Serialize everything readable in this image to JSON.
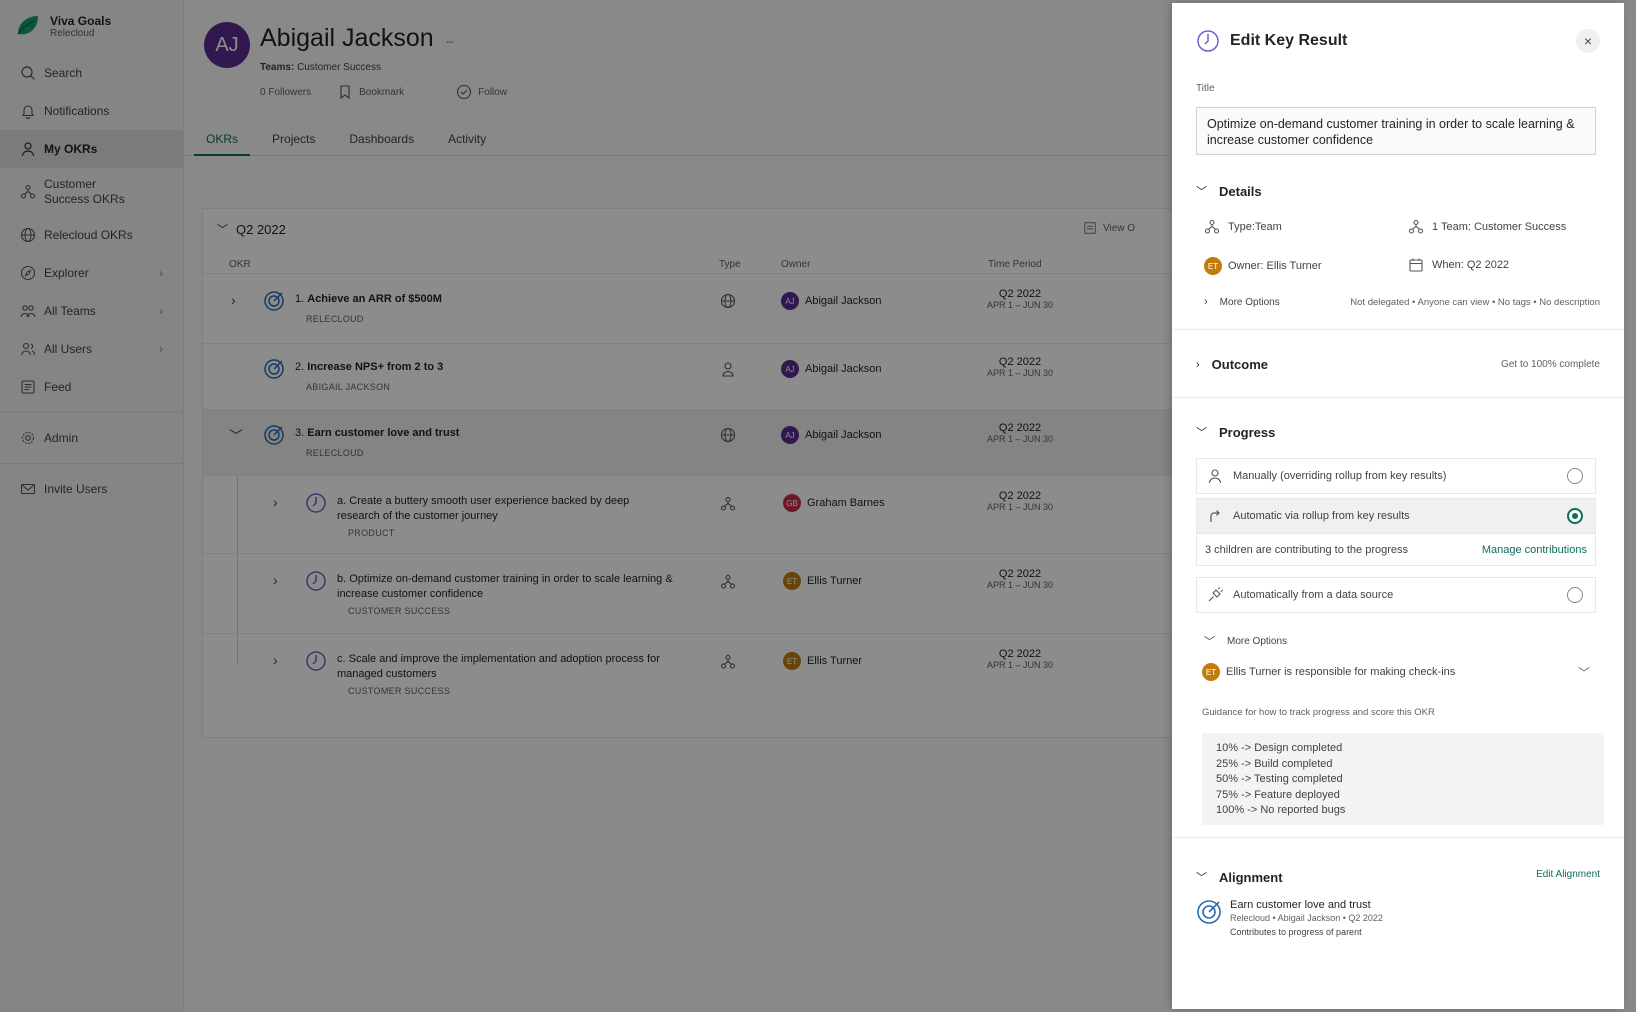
{
  "brand": {
    "name": "Viva Goals",
    "org": "Relecloud"
  },
  "sidebar": {
    "items": [
      {
        "label": "Search"
      },
      {
        "label": "Notifications"
      },
      {
        "label": "My OKRs"
      },
      {
        "label": "Customer Success OKRs"
      },
      {
        "label": "Relecloud OKRs"
      },
      {
        "label": "Explorer"
      },
      {
        "label": "All Teams"
      },
      {
        "label": "All Users"
      },
      {
        "label": "Feed"
      },
      {
        "label": "Admin"
      },
      {
        "label": "Invite Users"
      }
    ]
  },
  "profile": {
    "initials": "AJ",
    "name": "Abigail Jackson",
    "teams_label": "Teams:",
    "teams_value": "Customer Success",
    "followers": "0 Followers",
    "bookmark": "Bookmark",
    "follow": "Follow"
  },
  "tabs": [
    {
      "label": "OKRs"
    },
    {
      "label": "Projects"
    },
    {
      "label": "Dashboards"
    },
    {
      "label": "Activity"
    }
  ],
  "okr_table": {
    "period": "Q2 2022",
    "view_options": "View O",
    "columns": {
      "okr": "OKR",
      "type": "Type",
      "owner": "Owner",
      "time": "Time Period"
    },
    "rows": [
      {
        "num": "1.",
        "title": "Achieve an ARR of $500M",
        "sub": "RELECLOUD",
        "owner": "Abigail Jackson",
        "owner_initials": "AJ",
        "quarter": "Q2 2022",
        "range": "APR 1 – JUN 30"
      },
      {
        "num": "2.",
        "title": "Increase NPS+ from 2 to 3",
        "sub": "ABIGAIL JACKSON",
        "owner": "Abigail Jackson",
        "owner_initials": "AJ",
        "quarter": "Q2 2022",
        "range": "APR 1 – JUN 30"
      },
      {
        "num": "3.",
        "title": "Earn customer love and trust",
        "sub": "RELECLOUD",
        "owner": "Abigail Jackson",
        "owner_initials": "AJ",
        "quarter": "Q2 2022",
        "range": "APR 1 – JUN 30"
      },
      {
        "num": "a.",
        "title": "Create a buttery smooth user experience backed by deep research of the customer journey",
        "sub": "PRODUCT",
        "owner": "Graham Barnes",
        "owner_initials": "GB",
        "quarter": "Q2 2022",
        "range": "APR 1 – JUN 30"
      },
      {
        "num": "b.",
        "title": "Optimize on-demand customer training in order to scale learning & increase customer confidence",
        "sub": "CUSTOMER SUCCESS",
        "owner": "Ellis Turner",
        "owner_initials": "ET",
        "quarter": "Q2 2022",
        "range": "APR 1 – JUN 30"
      },
      {
        "num": "c.",
        "title": "Scale and improve the implementation and adoption process for managed customers",
        "sub": "CUSTOMER SUCCESS",
        "owner": "Ellis Turner",
        "owner_initials": "ET",
        "quarter": "Q2 2022",
        "range": "APR 1 – JUN 30"
      }
    ]
  },
  "panel": {
    "title": "Edit Key Result",
    "close": "×",
    "title_label": "Title",
    "title_value": "Optimize on-demand customer training in order to scale learning & increase customer confidence",
    "details": {
      "heading": "Details",
      "type": "Type:Team",
      "teams": "1 Team: Customer Success",
      "owner_initials": "ET",
      "owner": "Owner: Ellis Turner",
      "when": "When: Q2 2022",
      "more_options": "More Options",
      "more_note": "Not delegated • Anyone can view • No tags • No description"
    },
    "outcome": {
      "heading": "Outcome",
      "note": "Get to 100% complete"
    },
    "progress": {
      "heading": "Progress",
      "manual": "Manually (overriding rollup from key results)",
      "auto": "Automatic via rollup from key results",
      "children": "3 children are contributing to the progress",
      "manage": "Manage contributions",
      "datasource": "Automatically from a data source",
      "more_options": "More Options",
      "checkin_initials": "ET",
      "checkin": "Ellis Turner is responsible for making check-ins",
      "guidance_label": "Guidance for how to track progress and score this OKR",
      "guidance": [
        "10% -> Design completed",
        "25% -> Build completed",
        "50% -> Testing completed",
        "75% -> Feature deployed",
        "100% -> No reported bugs"
      ]
    },
    "alignment": {
      "heading": "Alignment",
      "edit": "Edit Alignment",
      "item_title": "Earn customer love and trust",
      "item_meta": "Relecloud • Abigail Jackson • Q2 2022",
      "item_contrib": "Contributes to progress of parent"
    }
  },
  "colors": {
    "accent": "#0f6c5c",
    "avatar_aj": "#5c2d91",
    "avatar_gb": "#c4314b",
    "avatar_et": "#c27c0e"
  }
}
